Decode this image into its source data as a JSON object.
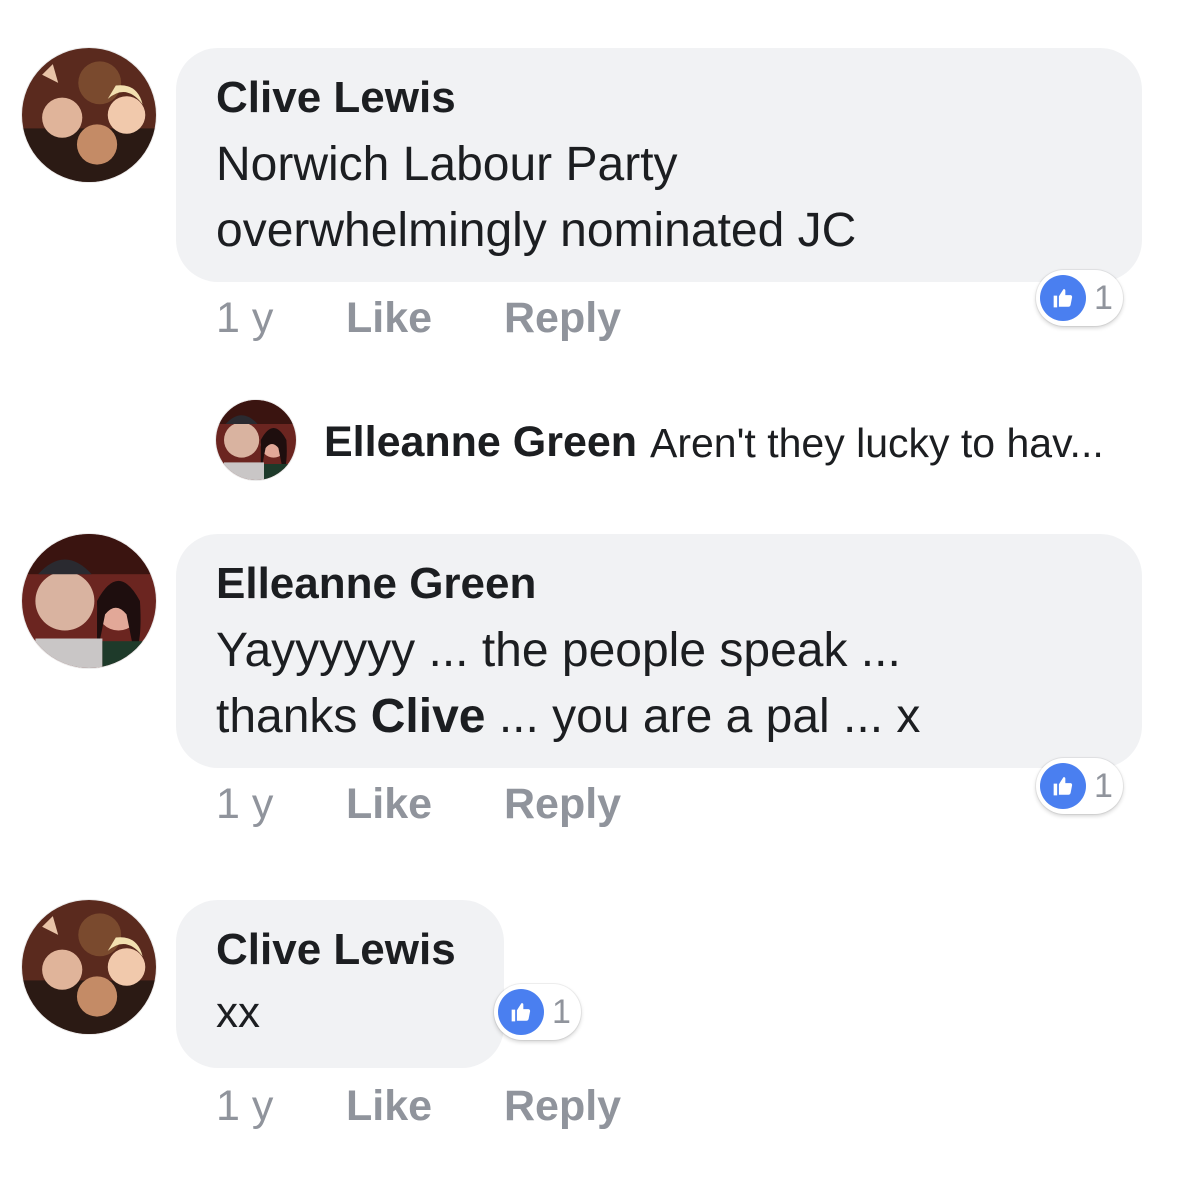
{
  "colors": {
    "bubble": "#f1f2f4",
    "meta": "#90949c",
    "like_blue": "#4a7ff0",
    "text": "#1c1e21"
  },
  "comments": [
    {
      "author": "Clive Lewis",
      "lines": [
        "Norwich Labour Party",
        "overwhelmingly nominated JC"
      ],
      "time": "1 y",
      "like_label": "Like",
      "reply_label": "Reply",
      "reaction_icon": "thumbs-up-icon",
      "reaction_count": "1"
    },
    {
      "author": "Elleanne Green",
      "line1": "Yayyyyyy ... the people speak ...",
      "line2_before": "thanks ",
      "line2_bold": "Clive",
      "line2_after": " ... you are a pal ... x",
      "time": "1 y",
      "like_label": "Like",
      "reply_label": "Reply",
      "reaction_icon": "thumbs-up-icon",
      "reaction_count": "1"
    },
    {
      "author": "Clive Lewis",
      "text": "xx",
      "time": "1 y",
      "like_label": "Like",
      "reply_label": "Reply",
      "reaction_icon": "thumbs-up-icon",
      "reaction_count": "1"
    }
  ],
  "reply_preview": {
    "author": "Elleanne Green",
    "text": "Aren't they lucky to hav..."
  }
}
